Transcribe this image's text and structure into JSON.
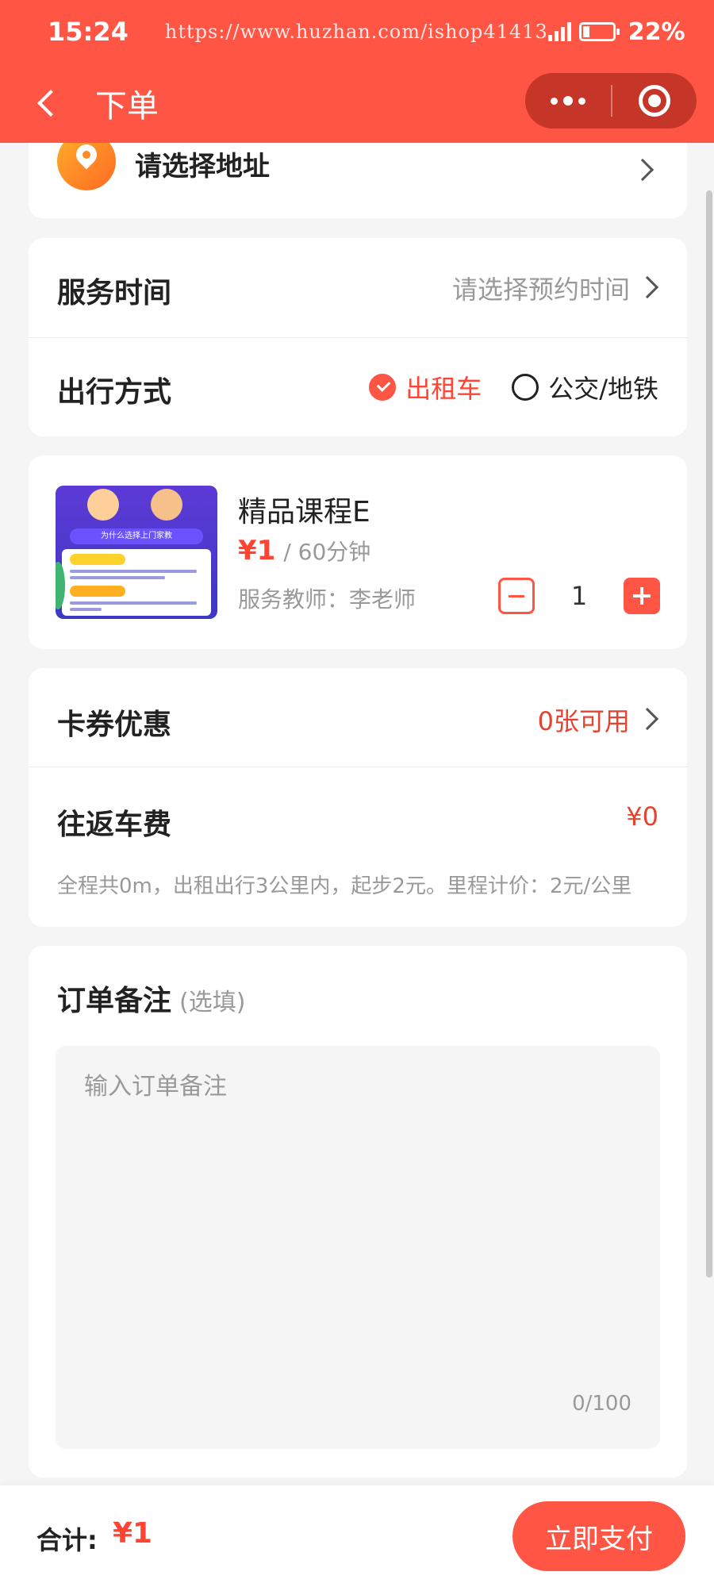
{
  "status_bar": {
    "time": "15:24",
    "url_overlay": "https://www.huzhan.com/ishop41413",
    "battery": "22%",
    "battery_level": 0.22
  },
  "nav": {
    "title": "下单"
  },
  "address": {
    "label": "请选择地址"
  },
  "service": {
    "time_label": "服务时间",
    "time_placeholder": "请选择预约时间",
    "travel_label": "出行方式",
    "travel_options": [
      {
        "label": "出租车",
        "selected": true
      },
      {
        "label": "公交/地铁",
        "selected": false
      }
    ]
  },
  "course": {
    "title": "精品课程E",
    "price": "¥1",
    "unit": "/ 60分钟",
    "teacher_label": "服务教师：李老师",
    "quantity": "1",
    "thumb_text": "为什么选择上门家教"
  },
  "fare": {
    "coupon_label": "卡券优惠",
    "coupon_value": "0张可用",
    "fare_label": "往返车费",
    "fare_value": "¥0",
    "fare_desc": "全程共0m，出租出行3公里内，起步2元。里程计价：2元/公里"
  },
  "remark": {
    "title": "订单备注",
    "optional": "(选填)",
    "placeholder": "输入订单备注",
    "count": "0/100"
  },
  "footer": {
    "total_label": "合计:",
    "total_value": "¥1",
    "pay_label": "立即支付"
  },
  "colors": {
    "accent": "#ff5544",
    "price": "#ff4433",
    "background": "#f5f5f5"
  }
}
